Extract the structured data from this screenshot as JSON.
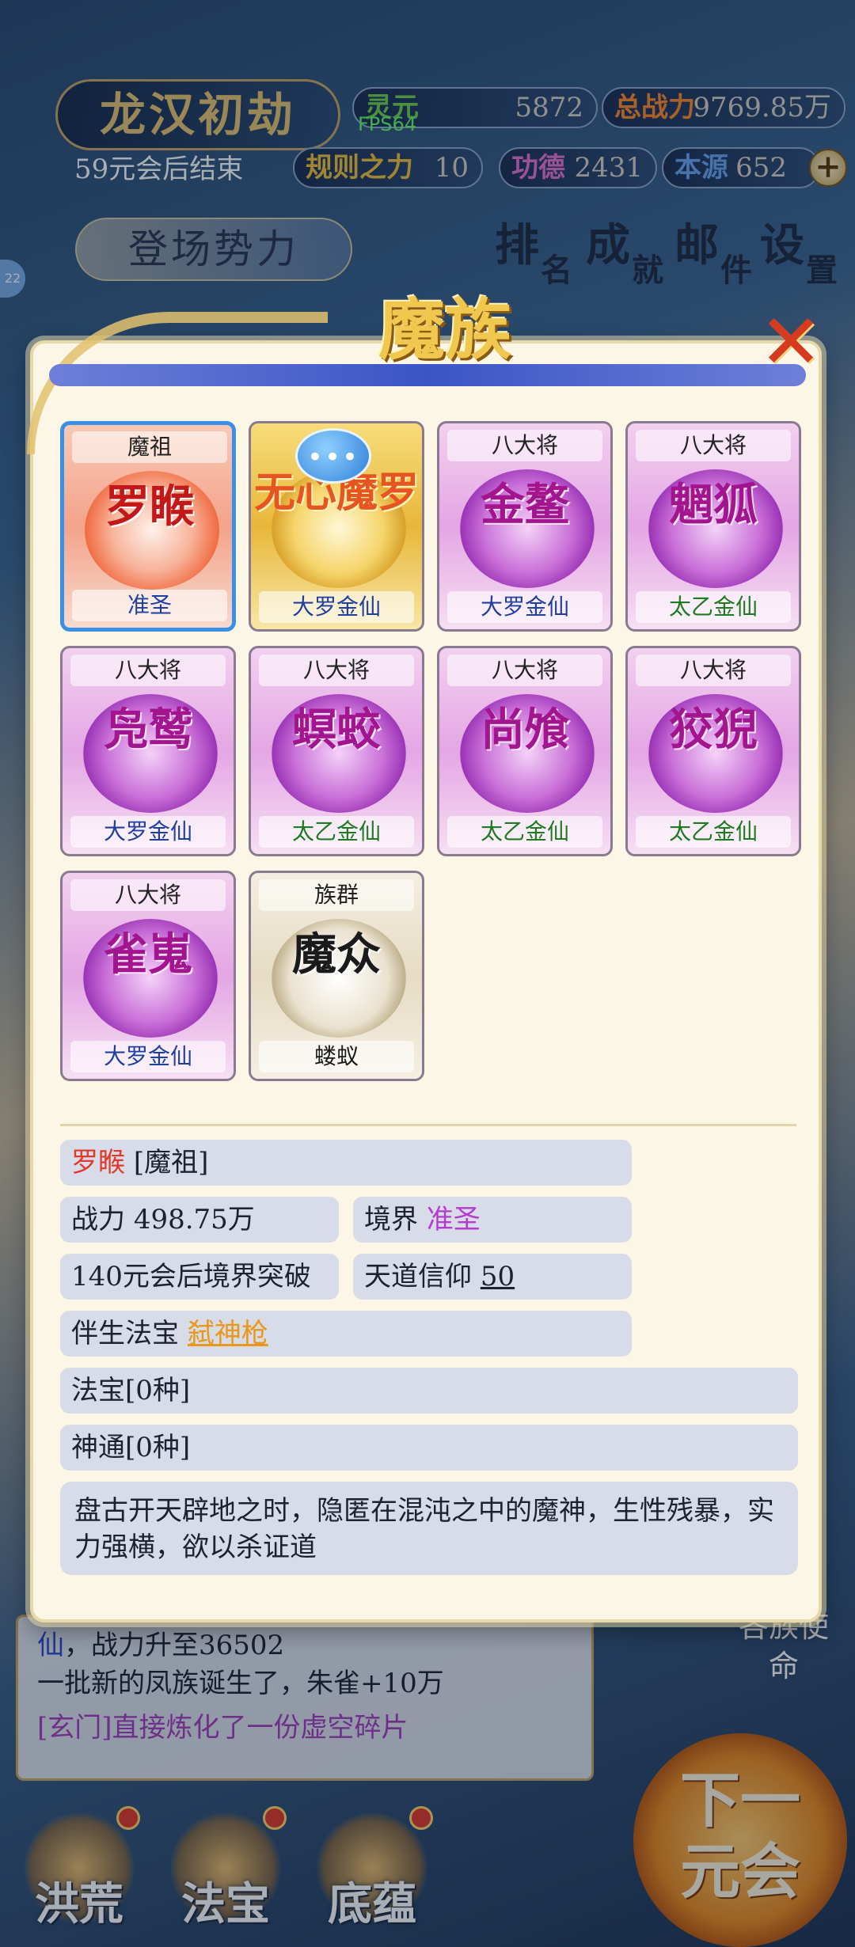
{
  "hud": {
    "realm_title": "龙汉初劫",
    "countdown": "59元会后结束",
    "fps": "FPS64",
    "level_badge": "22",
    "stats": {
      "lingyuan": {
        "label": "灵元",
        "value": "5872"
      },
      "zhanli": {
        "label": "总战力",
        "value": "9769.85万"
      },
      "guize": {
        "label": "规则之力",
        "value": "10"
      },
      "gongde": {
        "label": "功德",
        "value": "2431"
      },
      "benyuan": {
        "label": "本源",
        "value": "652"
      }
    },
    "plus_icon": "+",
    "forces_button": "登场势力",
    "nav": [
      {
        "big": "排",
        "small": "名"
      },
      {
        "big": "成",
        "small": "就"
      },
      {
        "big": "邮",
        "small": "件"
      },
      {
        "big": "设",
        "small": "置"
      }
    ]
  },
  "modal": {
    "title": "魔族",
    "close_icon": "✕",
    "chat_icon": "•••",
    "cards": [
      {
        "rank": "魔祖",
        "name": "罗睺",
        "realm": "准圣",
        "style": "red"
      },
      {
        "rank": "",
        "name": "无心魔罗",
        "realm": "大罗金仙",
        "style": "gold"
      },
      {
        "rank": "八大将",
        "name": "金鳌",
        "realm": "大罗金仙",
        "style": "purple"
      },
      {
        "rank": "八大将",
        "name": "魍狐",
        "realm": "太乙金仙",
        "style": "purple"
      },
      {
        "rank": "八大将",
        "name": "凫鹫",
        "realm": "大罗金仙",
        "style": "purple"
      },
      {
        "rank": "八大将",
        "name": "螟蛟",
        "realm": "太乙金仙",
        "style": "purple"
      },
      {
        "rank": "八大将",
        "name": "尚飧",
        "realm": "太乙金仙",
        "style": "purple"
      },
      {
        "rank": "八大将",
        "name": "狡猊",
        "realm": "太乙金仙",
        "style": "purple"
      },
      {
        "rank": "八大将",
        "name": "雀嵬",
        "realm": "大罗金仙",
        "style": "purple"
      },
      {
        "rank": "族群",
        "name": "魔众",
        "realm": "蝼蚁",
        "style": "white"
      }
    ],
    "detail": {
      "name": "罗睺",
      "title_tag": "[魔祖]",
      "power_label": "战力",
      "power_value": "498.75万",
      "realm_label": "境界",
      "realm_value": "准圣",
      "breakthrough": "140元会后境界突破",
      "faith_label": "天道信仰",
      "faith_value": "50",
      "treasure_label": "伴生法宝",
      "treasure_value": "弑神枪",
      "fabao": "法宝[0种]",
      "shentong": "神通[0种]",
      "description": "盘古开天辟地之时，隐匿在混沌之中的魔神，生性残暴，实力强横，欲以杀证道"
    }
  },
  "log": {
    "line1_prefix": "仙",
    "line1_rest": "，战力升至36502",
    "line2": "一批新的凤族诞生了，朱雀+10万",
    "line3": "[玄门]直接炼化了一份虚空碎片"
  },
  "mission_button": "各族使命",
  "bottom_nav": [
    "洪荒",
    "法宝",
    "底蕴"
  ],
  "next_button": {
    "line1": "下一",
    "line2": "元会"
  }
}
